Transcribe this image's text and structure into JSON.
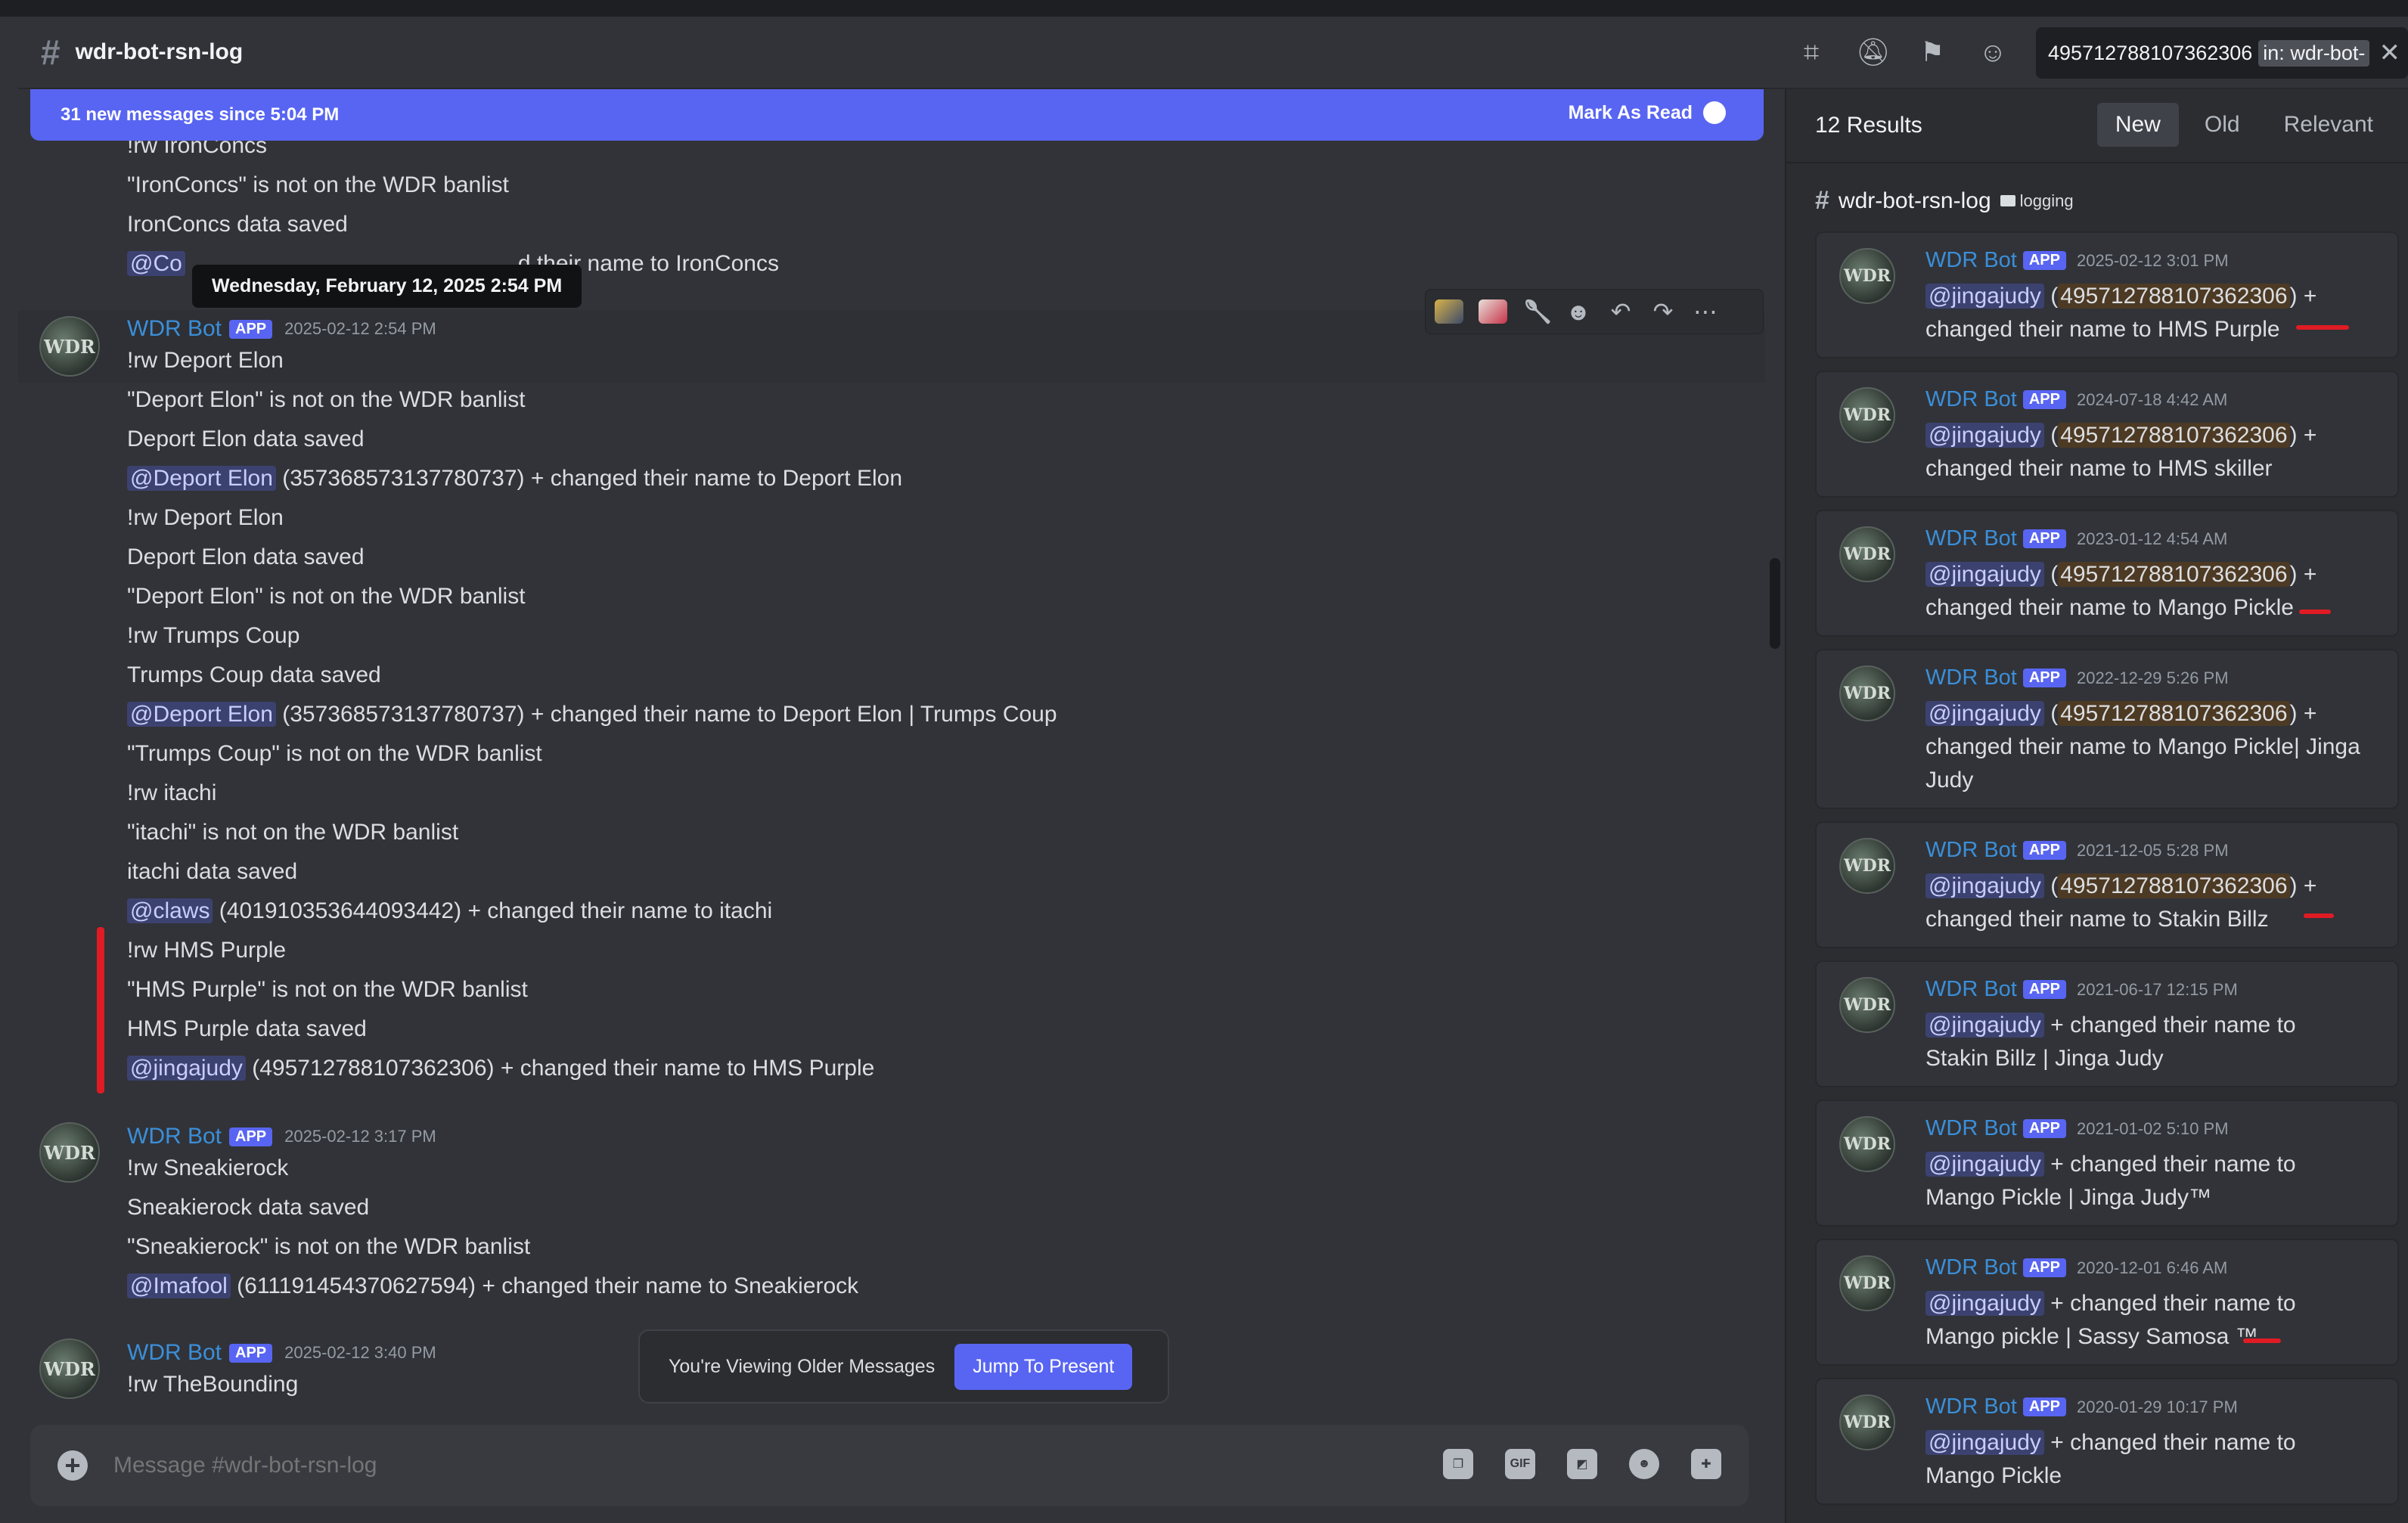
{
  "channel": {
    "name": "wdr-bot-rsn-log"
  },
  "header": {
    "icons": [
      "threads-icon",
      "mute-bell-icon",
      "pin-icon",
      "members-icon"
    ],
    "search": {
      "query": "495712788107362306",
      "filter_chip": "in: wdr-bot-"
    }
  },
  "new_messages_bar": {
    "text": "31 new messages since 5:04 PM",
    "action": "Mark As Read"
  },
  "tooltip": "Wednesday, February 12, 2025 2:54 PM",
  "chat": {
    "top_lines": [
      "!rw IronConcs",
      "\"IronConcs\" is not on the WDR banlist",
      "IronConcs data saved"
    ],
    "top_mention_line": {
      "mention": "@Co",
      "rest": "d their name to IronConcs"
    },
    "group1": {
      "author": "WDR Bot",
      "badge": "APP",
      "time": "2025-02-12 2:54 PM",
      "lines": [
        "!rw Deport Elon",
        "\"Deport Elon\" is not on the WDR banlist",
        "Deport Elon data saved"
      ],
      "mention1": {
        "mention": "@Deport Elon",
        "rest": " (357368573137780737) + changed their name to Deport Elon"
      },
      "lines2": [
        "!rw Deport Elon",
        "Deport Elon data saved",
        "\"Deport Elon\" is not on the WDR banlist",
        "!rw Trumps Coup",
        "Trumps Coup data saved"
      ],
      "mention2": {
        "mention": "@Deport Elon",
        "rest": " (357368573137780737) + changed their name to Deport Elon | Trumps Coup"
      },
      "lines3": [
        "\"Trumps Coup\" is not on the WDR banlist",
        "!rw itachi",
        "\"itachi\" is not on the WDR banlist",
        "itachi data saved"
      ],
      "mention3": {
        "mention": "@claws",
        "rest": " (401910353644093442) + changed their name to itachi"
      },
      "lines4": [
        "!rw HMS Purple",
        "\"HMS Purple\" is not on the WDR banlist",
        "HMS Purple data saved"
      ],
      "mention4": {
        "mention": "@jingajudy",
        "rest": " (495712788107362306) + changed their name to HMS Purple"
      }
    },
    "group2": {
      "author": "WDR Bot",
      "badge": "APP",
      "time": "2025-02-12 3:17 PM",
      "lines": [
        "!rw Sneakierock",
        "Sneakierock data saved",
        "\"Sneakierock\" is not on the WDR banlist"
      ],
      "mention": {
        "mention": "@Imafool",
        "rest": " (611191454370627594) + changed their name to Sneakierock"
      }
    },
    "group3": {
      "author": "WDR Bot",
      "badge": "APP",
      "time": "2025-02-12 3:40 PM",
      "lines": [
        "!rw TheBounding"
      ]
    },
    "avatar_text": "WDR"
  },
  "older_messages": {
    "text": "You're Viewing Older Messages",
    "button": "Jump To Present"
  },
  "composer": {
    "placeholder": "Message #wdr-bot-rsn-log",
    "icons": [
      "gift-icon",
      "gif-icon",
      "sticker-icon",
      "emoji-icon",
      "gamepad-icon"
    ]
  },
  "search_panel": {
    "count": "12 Results",
    "tabs": [
      "New",
      "Old",
      "Relevant"
    ],
    "active_tab": "New",
    "channel": "wdr-bot-rsn-log",
    "category": "logging",
    "results": [
      {
        "author": "WDR Bot",
        "badge": "APP",
        "time": "2025-02-12 3:01 PM",
        "mention": "@jingajudy",
        "id": "495712788107362306",
        "text1": " +",
        "text2": "changed their name to HMS Purple"
      },
      {
        "author": "WDR Bot",
        "badge": "APP",
        "time": "2024-07-18 4:42 AM",
        "mention": "@jingajudy",
        "id": "495712788107362306",
        "text1": " +",
        "text2": "changed their name to HMS skiller"
      },
      {
        "author": "WDR Bot",
        "badge": "APP",
        "time": "2023-01-12 4:54 AM",
        "mention": "@jingajudy",
        "id": "495712788107362306",
        "text1": " +",
        "text2": "changed their name to Mango Pickle"
      },
      {
        "author": "WDR Bot",
        "badge": "APP",
        "time": "2022-12-29 5:26 PM",
        "mention": "@jingajudy",
        "id": "495712788107362306",
        "text1": " +",
        "text2": "changed their name to Mango Pickle| Jinga Judy"
      },
      {
        "author": "WDR Bot",
        "badge": "APP",
        "time": "2021-12-05 5:28 PM",
        "mention": "@jingajudy",
        "id": "495712788107362306",
        "text1": " +",
        "text2": "changed their name to Stakin Billz"
      },
      {
        "author": "WDR Bot",
        "badge": "APP",
        "time": "2021-06-17 12:15 PM",
        "mention": "@jingajudy",
        "text1": " + changed their name to",
        "text2": "Stakin Billz | Jinga Judy"
      },
      {
        "author": "WDR Bot",
        "badge": "APP",
        "time": "2021-01-02 5:10 PM",
        "mention": "@jingajudy",
        "text1": " + changed their name to",
        "text2": "Mango Pickle | Jinga Judy™"
      },
      {
        "author": "WDR Bot",
        "badge": "APP",
        "time": "2020-12-01 6:46 AM",
        "mention": "@jingajudy",
        "text1": " + changed their name to",
        "text2": "Mango pickle | Sassy Samosa ™"
      },
      {
        "author": "WDR Bot",
        "badge": "APP",
        "time": "2020-01-29 10:17 PM",
        "mention": "@jingajudy",
        "text1": " + changed their name to",
        "text2": "Mango Pickle"
      }
    ]
  },
  "colors": {
    "accent": "#5865f2",
    "author": "#3b8fd9",
    "annotation": "#e01b24"
  }
}
